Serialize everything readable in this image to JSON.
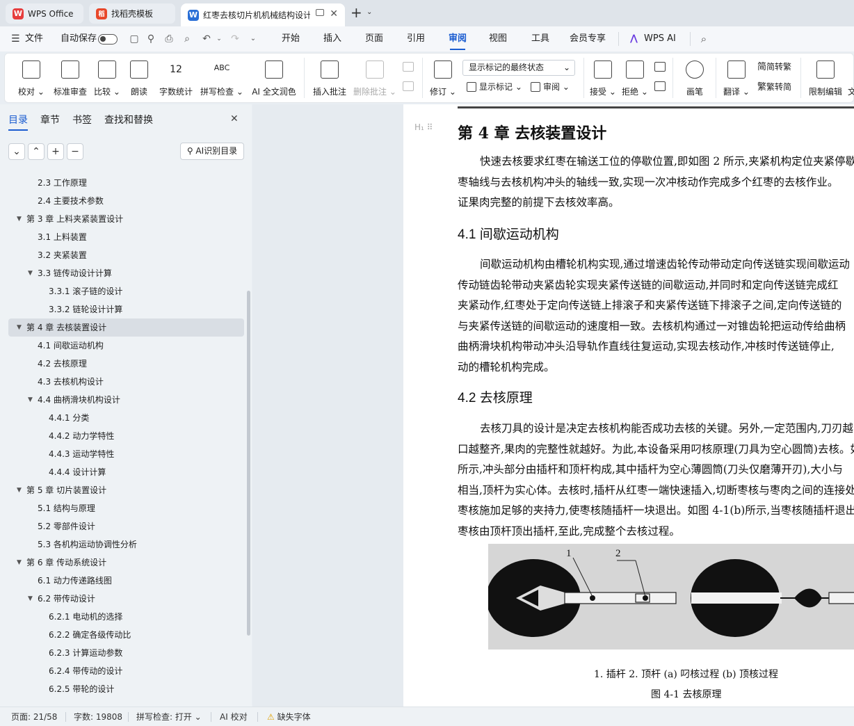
{
  "tabs": [
    {
      "label": "WPS Office",
      "logo": "W",
      "color": "#e63d3d"
    },
    {
      "label": "找稻壳模板",
      "logo": "稻",
      "color": "#e8472a"
    },
    {
      "label": "红枣去核切片机机械结构设计",
      "logo": "W",
      "color": "#2a6fd6"
    }
  ],
  "menu": {
    "file": "文件",
    "autosave": "自动保存",
    "items": [
      "开始",
      "插入",
      "页面",
      "引用",
      "审阅",
      "视图",
      "工具",
      "会员专享",
      "WPS AI"
    ],
    "active": "审阅"
  },
  "ribbon": {
    "proof": "校对",
    "standard": "标准审查",
    "compare": "比较",
    "read": "朗读",
    "wordcount": "字数统计",
    "spell": "拼写检查",
    "ai_polish": "AI 全文润色",
    "insert_comment": "插入批注",
    "delete_comment": "删除批注",
    "revise": "修订",
    "markup_select": "显示标记的最终状态",
    "show_markup": "显示标记",
    "review": "审阅",
    "accept": "接受",
    "reject": "拒绝",
    "pen": "画笔",
    "translate": "翻译",
    "to_trad": "简转繁",
    "to_simp": "繁转简",
    "restrict": "限制编辑",
    "more": "文"
  },
  "sidebar": {
    "tabs": [
      "目录",
      "章节",
      "书签",
      "查找和替换"
    ],
    "ai_button": "AI识别目录",
    "toc": [
      {
        "text": "2.3 工作原理",
        "level": 2
      },
      {
        "text": "2.4  主要技术参数",
        "level": 2
      },
      {
        "text": "第 3 章  上料夹紧装置设计",
        "level": 1,
        "expanded": true
      },
      {
        "text": "3.1  上料装置",
        "level": 2
      },
      {
        "text": "3.2  夹紧装置",
        "level": 2
      },
      {
        "text": "3.3  链传动设计计算",
        "level": 2,
        "expanded": true
      },
      {
        "text": "3.3.1 滚子链的设计",
        "level": 3
      },
      {
        "text": "3.3.2 链轮设计计算",
        "level": 3
      },
      {
        "text": "第 4 章  去核装置设计",
        "level": 1,
        "expanded": true,
        "selected": true
      },
      {
        "text": "4.1 间歇运动机构",
        "level": 2
      },
      {
        "text": "4.2 去核原理",
        "level": 2
      },
      {
        "text": "4.3 去核机构设计",
        "level": 2
      },
      {
        "text": "4.4 曲柄滑块机构设计",
        "level": 2,
        "expanded": true
      },
      {
        "text": "4.4.1 分类",
        "level": 3
      },
      {
        "text": "4.4.2 动力学特性",
        "level": 3
      },
      {
        "text": "4.4.3 运动学特性",
        "level": 3
      },
      {
        "text": "4.4.4 设计计算",
        "level": 3
      },
      {
        "text": "第 5 章  切片装置设计",
        "level": 1,
        "expanded": true
      },
      {
        "text": "5.1 结构与原理",
        "level": 2
      },
      {
        "text": "5.2 零部件设计",
        "level": 2
      },
      {
        "text": "5.3 各机构运动协调性分析",
        "level": 2
      },
      {
        "text": "第 6 章  传动系统设计",
        "level": 1,
        "expanded": true
      },
      {
        "text": "6.1 动力传递路线图",
        "level": 2
      },
      {
        "text": "6.2 带传动设计",
        "level": 2,
        "expanded": true
      },
      {
        "text": "6.2.1 电动机的选择",
        "level": 3
      },
      {
        "text": "6.2.2 确定各级传动比",
        "level": 3
      },
      {
        "text": "6.2.3 计算运动参数",
        "level": 3
      },
      {
        "text": "6.2.4 带传动的设计",
        "level": 3
      },
      {
        "text": "6.2.5 带轮的设计",
        "level": 3
      }
    ]
  },
  "document": {
    "chapter": "第 4 章  去核装置设计",
    "p1": [
      "快速去核要求红枣在输送工位的停歇位置,即如图 2 所示,夹紧机构定位夹紧停歇",
      "枣轴线与去核机构冲头的轴线一致,实现一次冲核动作完成多个红枣的去核作业。",
      "证果肉完整的前提下去核效率高。"
    ],
    "h41": "4.1 间歇运动机构",
    "p2": [
      "间歇运动机构由槽轮机构实现,通过增速齿轮传动带动定向传送链实现间歇运动",
      "传动链齿轮带动夹紧齿轮实现夹紧传送链的间歇运动,并同时和定向传送链完成红",
      "夹紧动作,红枣处于定向传送链上排滚子和夹紧传送链下排滚子之间,定向传送链的",
      "与夹紧传送链的间歇运动的速度相一致。去核机构通过一对锥齿轮把运动传给曲柄",
      "曲柄滑块机构带动冲头沿导轨作直线往复运动,实现去核动作,冲核时传送链停止,",
      "动的槽轮机构完成。"
    ],
    "h42": "4.2 去核原理",
    "p3": [
      "去核刀具的设计是决定去核机构能否成功去核的关键。另外,一定范围内,刀刃越",
      "口越整齐,果肉的完整性就越好。为此,本设备采用叼核原理(刀具为空心圆筒)去核。如",
      "所示,冲头部分由插杆和顶杆构成,其中插杆为空心薄圆筒(刀头仅磨薄开刃),大小与",
      "相当,顶杆为实心体。去核时,插杆从红枣一端快速插入,切断枣核与枣肉之间的连接处",
      "枣核施加足够的夹持力,使枣核随插杆一块退出。如图 4-1(b)所示,当枣核随插杆退出",
      "枣核由顶杆顶出插杆,至此,完成整个去核过程。"
    ],
    "figure_labels": [
      "1",
      "2"
    ],
    "caption1": "1. 插杆 2. 顶杆 (a) 叼核过程 (b) 顶核过程",
    "caption2": "图 4-1 去核原理"
  },
  "status": {
    "page": "页面: 21/58",
    "words": "字数: 19808",
    "spell": "拼写检查: 打开",
    "ai": "AI 校对",
    "font": "缺失字体"
  }
}
